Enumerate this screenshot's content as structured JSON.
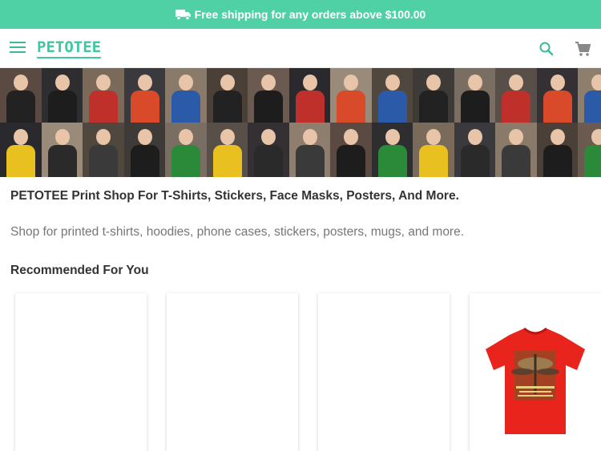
{
  "promo": {
    "text": "Free shipping for any orders above $100.00"
  },
  "header": {
    "logo": "PETOTEE",
    "menu_icon": "hamburger-menu-icon",
    "search_icon": "search-icon",
    "cart_icon": "shopping-cart-icon"
  },
  "colors": {
    "accent": "#4fd1a5",
    "logo": "#3ec7a1",
    "text": "#333333",
    "muted": "#777777"
  },
  "main": {
    "headline": "PETOTEE Print Shop For T-Shirts, Stickers, Face Masks, Posters, And More.",
    "subline": "Shop for printed t-shirts, hoodies, phone cases, stickers, posters, mugs, and more.",
    "recommended_title": "Recommended For You"
  },
  "products": [
    {
      "image": "blank"
    },
    {
      "image": "blank"
    },
    {
      "image": "blank"
    },
    {
      "image": "red-tshirt-sing-me-a-song"
    }
  ]
}
